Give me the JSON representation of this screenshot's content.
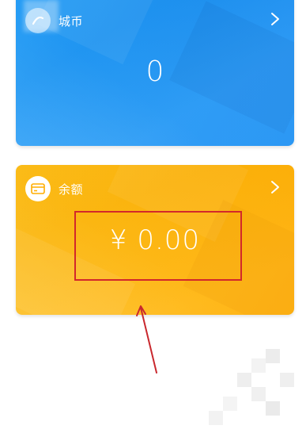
{
  "coin_card": {
    "title": "城币",
    "value": "0",
    "icon": "coin-logo-icon",
    "accent": "#1e96f5"
  },
  "balance_card": {
    "title": "余额",
    "value": "¥ 0.00",
    "icon": "wallet-icon",
    "accent": "#ffb60a"
  },
  "annotation": {
    "box_color": "#d2282b",
    "arrow_color": "#c9282e"
  }
}
